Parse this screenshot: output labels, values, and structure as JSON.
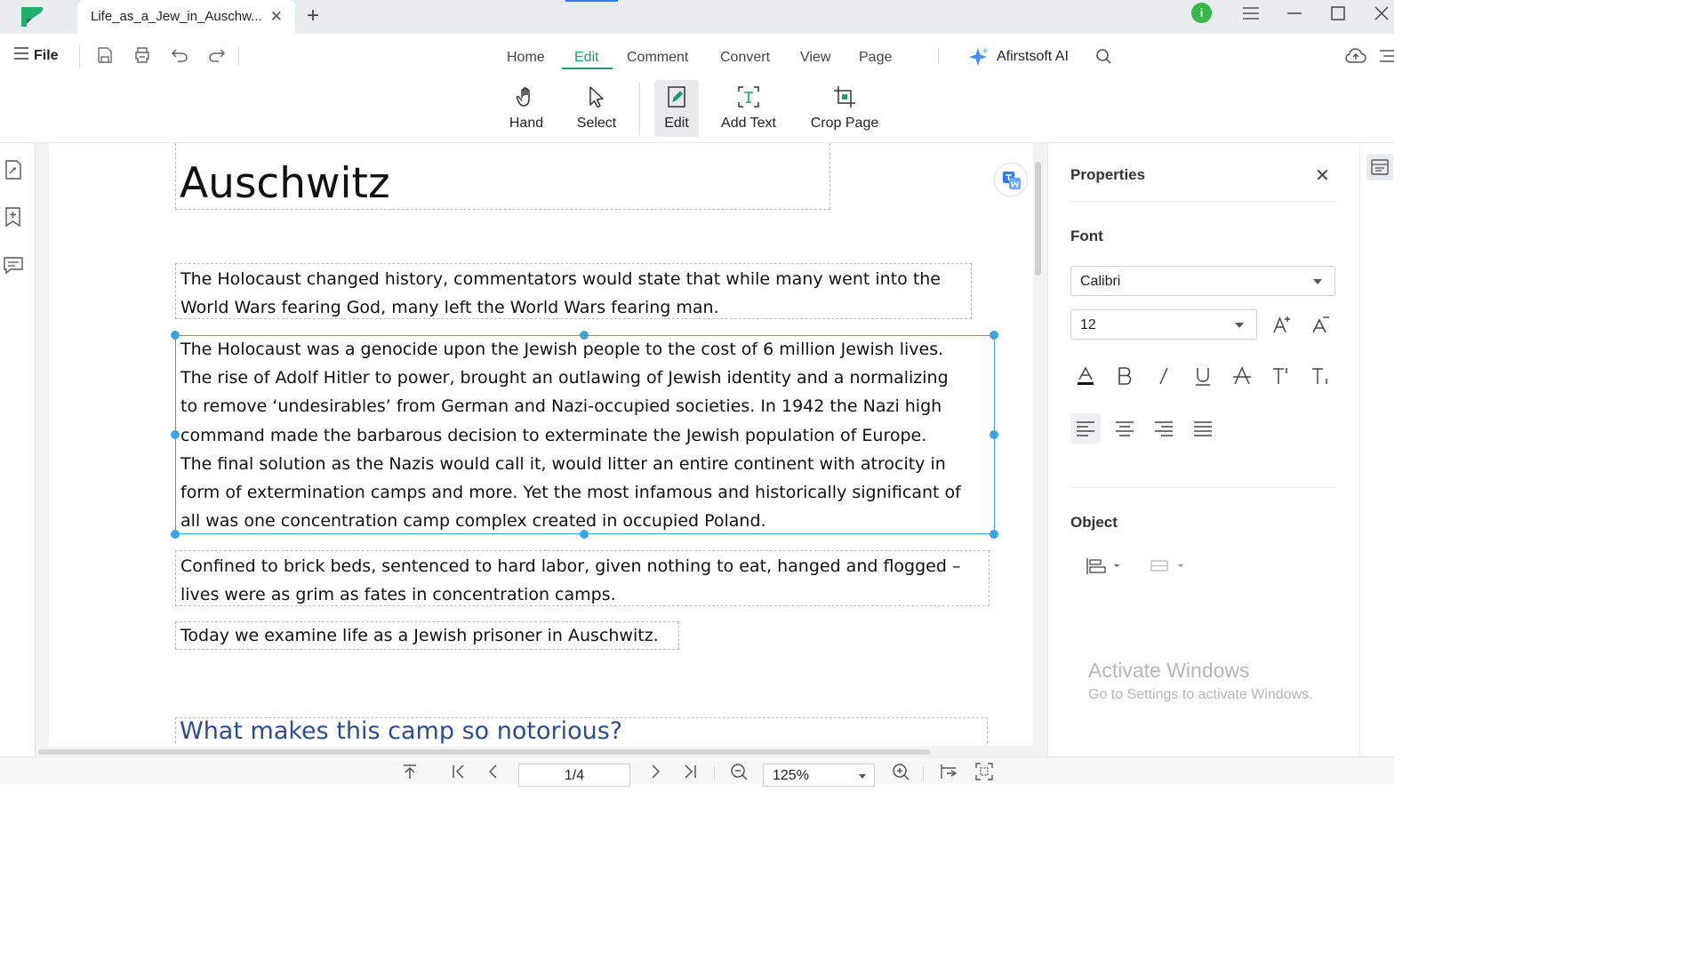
{
  "tab": {
    "title": "Life_as_a_Jew_in_Auschw...",
    "close": "✕",
    "new": "+"
  },
  "user": {
    "initial": "i"
  },
  "menu": {
    "file": "File",
    "tabs": [
      "Home",
      "Edit",
      "Comment",
      "Convert",
      "View",
      "Page"
    ],
    "active_tab": "Edit",
    "ai_label": "Afirstsoft AI"
  },
  "ribbon": {
    "hand": "Hand",
    "select": "Select",
    "edit": "Edit",
    "add_text": "Add Text",
    "crop_page": "Crop Page"
  },
  "document": {
    "title": "Auschwitz",
    "para1": [
      "The Holocaust changed history, commentators would state that while many went into the",
      "World Wars fearing God, many left the World Wars fearing man."
    ],
    "para2": [
      "The Holocaust was a genocide upon the Jewish people to the cost of 6 million Jewish lives.",
      "The rise of Adolf Hitler to power, brought an outlawing of Jewish identity and a normalizing",
      "to remove ‘undesirables’ from German and Nazi-occupied societies. In 1942 the Nazi high",
      "command made the barbarous decision to exterminate the Jewish population of Europe.",
      "The final solution as the Nazis would call it, would litter an entire continent with atrocity in",
      "form of extermination camps and more. Yet the most infamous and historically significant of",
      "all was one concentration camp complex created in occupied Poland."
    ],
    "para3": [
      "Confined to brick beds, sentenced to hard labor, given nothing to eat, hanged and flogged –",
      "lives were as grim as fates in concentration camps."
    ],
    "para4": "Today we examine life as a Jewish prisoner in Auschwitz.",
    "heading": "What makes this camp so notorious?"
  },
  "properties": {
    "title": "Properties",
    "close": "✕",
    "font_section": "Font",
    "font_family": "Calibri",
    "font_size": "12",
    "object_section": "Object"
  },
  "watermark": {
    "title": "Activate Windows",
    "subtitle": "Go to Settings to activate Windows."
  },
  "statusbar": {
    "page": "1/4",
    "zoom": "125%"
  },
  "colors": {
    "accent": "#1e9c6a",
    "selection": "#3aa6e0",
    "heading": "#2e4d8f"
  }
}
